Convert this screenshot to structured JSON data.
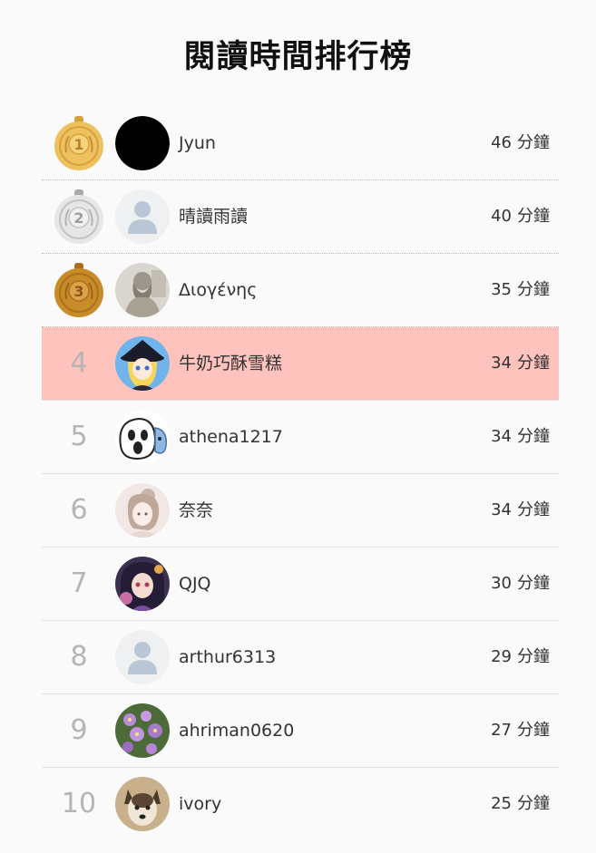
{
  "title": "閱讀時間排行榜",
  "unit": "分鐘",
  "colors": {
    "gold": "#eec15f",
    "silver": "#e6e6e6",
    "bronze": "#c98b28",
    "highlight": "#ffc3bd",
    "rank_text": "#b5b5b5"
  },
  "entries": [
    {
      "rank": "1",
      "medal": "gold",
      "avatar": "black-circle",
      "name": "Jyun",
      "minutes": "46"
    },
    {
      "rank": "2",
      "medal": "silver",
      "avatar": "default-user",
      "name": "晴讀雨讀",
      "minutes": "40"
    },
    {
      "rank": "3",
      "medal": "bronze",
      "avatar": "statue-photo",
      "name": "Διογένης",
      "minutes": "35"
    },
    {
      "rank": "4",
      "avatar": "anime-witch-girl",
      "name": "牛奶巧酥雪糕",
      "minutes": "34",
      "highlighted": true
    },
    {
      "rank": "5",
      "avatar": "ghost-cartoon",
      "name": "athena1217",
      "minutes": "34"
    },
    {
      "rank": "6",
      "avatar": "illustrated-girl",
      "name": "奈奈",
      "minutes": "34"
    },
    {
      "rank": "7",
      "avatar": "anime-girl-dark",
      "name": "QJQ",
      "minutes": "30"
    },
    {
      "rank": "8",
      "avatar": "default-user",
      "name": "arthur6313",
      "minutes": "29"
    },
    {
      "rank": "9",
      "avatar": "purple-flowers",
      "name": "ahriman0620",
      "minutes": "27"
    },
    {
      "rank": "10",
      "avatar": "dog-photo",
      "name": "ivory",
      "minutes": "25"
    }
  ]
}
